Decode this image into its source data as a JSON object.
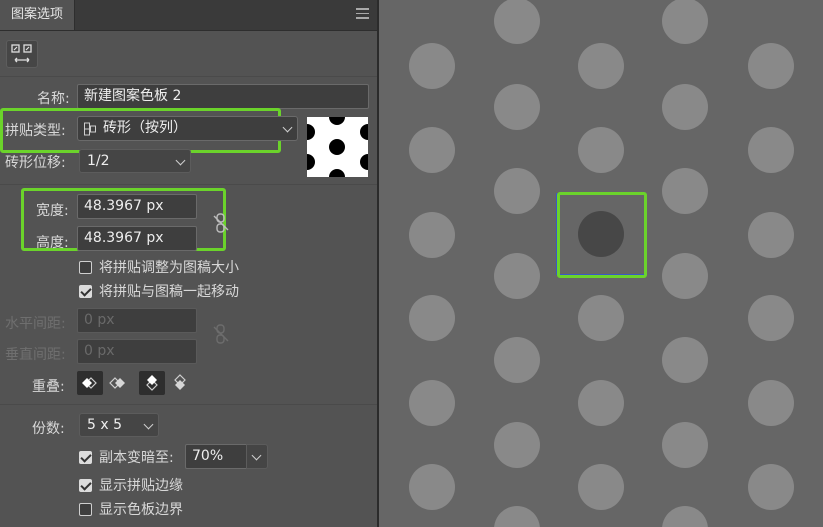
{
  "panel": {
    "tab_label": "图案选项",
    "name_label": "名称:",
    "name_value": "新建图案色板 2",
    "tile_type_label": "拼贴类型:",
    "tile_type_value": "砖形（按列）",
    "brick_offset_label": "砖形位移:",
    "brick_offset_value": "1/2",
    "width_label": "宽度:",
    "width_value": "48.3967 px",
    "height_label": "高度:",
    "height_value": "48.3967 px",
    "size_tile_to_art_label": "将拼贴调整为图稿大小",
    "size_tile_to_art_checked": false,
    "move_tile_with_art_label": "将拼贴与图稿一起移动",
    "move_tile_with_art_checked": true,
    "h_spacing_label": "水平间距:",
    "h_spacing_value": "0 px",
    "v_spacing_label": "垂直间距:",
    "v_spacing_value": "0 px",
    "overlap_label": "重叠:",
    "copies_label": "份数:",
    "copies_value": "5 x 5",
    "dim_copies_label": "副本变暗至:",
    "dim_copies_checked": true,
    "dim_copies_value": "70%",
    "show_tile_edge_label": "显示拼贴边缘",
    "show_tile_edge_checked": true,
    "show_swatch_bounds_label": "显示色板边界",
    "show_swatch_bounds_checked": false
  },
  "colors": {
    "highlight": "#6bd32b",
    "panel_bg": "#535353",
    "canvas_bg": "#666666",
    "copy_dot": "#898989",
    "original_dot": "#474747"
  },
  "icons": {
    "tile_tool": "pattern-tile-tool-icon",
    "menu": "hamburger-menu-icon",
    "link": "unlinked-chain-icon"
  }
}
